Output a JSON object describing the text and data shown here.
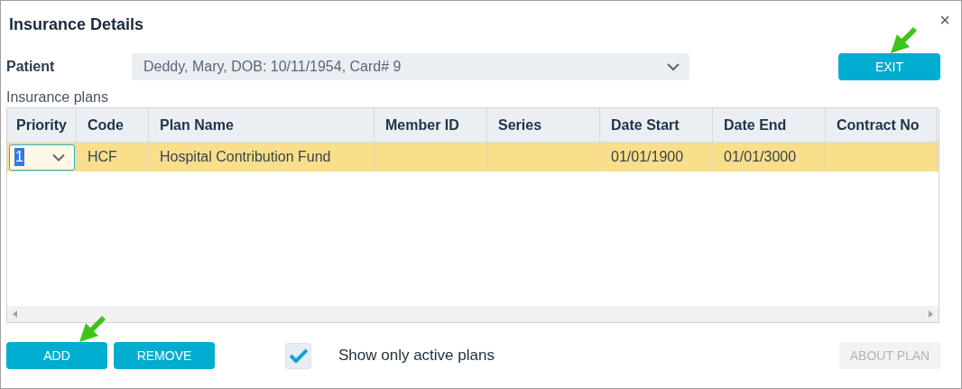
{
  "window": {
    "title": "Insurance Details",
    "close": "×"
  },
  "patient": {
    "label": "Patient",
    "value": "Deddy, Mary, DOB: 10/11/1954, Card# 9"
  },
  "exit_button": {
    "label": "EXIT"
  },
  "plans": {
    "label": "Insurance plans",
    "columns": [
      "Priority",
      "Code",
      "Plan Name",
      "Member ID",
      "Series",
      "Date Start",
      "Date End",
      "Contract No"
    ],
    "rows": [
      {
        "selected": true,
        "priority": "1",
        "code": "HCF",
        "plan_name": "Hospital Contribution Fund",
        "date_start": "01/01/1900",
        "date_end": "01/01/3000"
      }
    ]
  },
  "buttons": [
    {
      "label": "ADD",
      "disabled": false
    },
    {
      "label": "REMOVE",
      "disabled": false
    }
  ],
  "active_filter": {
    "label": "Show only active plans",
    "checked": true
  },
  "about_button": {
    "label": "ABOUT PLAN",
    "disabled": true
  }
}
